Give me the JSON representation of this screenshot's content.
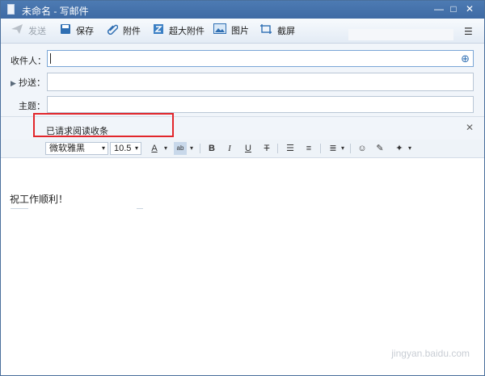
{
  "window": {
    "title": "未命名 - 写邮件"
  },
  "toolbar": {
    "send": "发送",
    "save": "保存",
    "attach": "附件",
    "super_attach": "超大附件",
    "image": "图片",
    "screenshot": "截屏"
  },
  "fields": {
    "to_label": "收件人：",
    "cc_label": "抄送：",
    "subject_label": "主题："
  },
  "notice": {
    "text": "已请求阅读收条"
  },
  "format": {
    "font": "微软雅黑",
    "size": "10.5",
    "bold": "B",
    "italic": "I",
    "underline": "U",
    "strike": "T"
  },
  "body": {
    "text": "祝工作顺利！"
  },
  "watermark": {
    "text": "jingyan.baidu.com"
  }
}
